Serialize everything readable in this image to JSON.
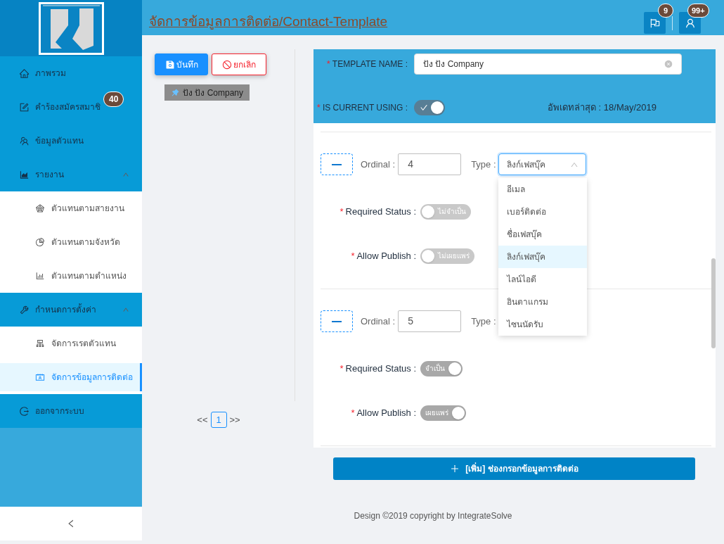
{
  "sidebar": {
    "items": [
      {
        "label": "ภาพรวม",
        "selected": false
      },
      {
        "label": "คำร้องสมัครสมาชิ",
        "badge": "40",
        "selected": false
      },
      {
        "label": "ข้อมูลตัวแทน",
        "selected": false
      },
      {
        "label": "รายงาน",
        "selected": false,
        "expanded": true,
        "children": [
          {
            "label": "ตัวแทนตามสายงาน",
            "selected": false
          },
          {
            "label": "ตัวแทนตามจังหวัด",
            "selected": false
          },
          {
            "label": "ตัวแทนตามตำแหน่ง",
            "selected": false
          }
        ]
      },
      {
        "label": "กำหนดการตั้งค่า",
        "selected": false,
        "expanded": true,
        "children": [
          {
            "label": "จัดการเรตตัวแทน",
            "selected": false
          },
          {
            "label": "จัดการข้อมูลการติดต่อ",
            "selected": true
          }
        ]
      },
      {
        "label": "ออกจากระบบ",
        "selected": false
      }
    ]
  },
  "header": {
    "title": "จัดการข้อมูลการติดต่อ/Contact-Template",
    "actions": [
      {
        "badge": "9"
      },
      {
        "badge": "99+"
      }
    ]
  },
  "toolbar": {
    "buttons": [
      {
        "label": "บันทึก",
        "kind": "primary"
      },
      {
        "label": "ยกเลิก",
        "kind": "danger"
      }
    ],
    "templates": [
      {
        "label": "ปัง ปัง Company"
      }
    ]
  },
  "pagination": {
    "prev": "<<",
    "pages": [
      {
        "label": "1",
        "selected": true
      }
    ],
    "next": ">>"
  },
  "template": {
    "name": {
      "mark": "*",
      "label": "TEMPLATE NAME :",
      "value": "ปัง ปัง Company"
    },
    "current": {
      "mark": "*",
      "label": "IS CURRENT USING :",
      "on": true
    },
    "updated": "อัพเดทล่าสุด : 18/May/2019"
  },
  "contacts": [
    {
      "ordinal": {
        "label": "Ordinal :",
        "value": "4"
      },
      "type": {
        "label": "Type :",
        "value": "ลิงก์เฟสบุ๊ค",
        "open": true,
        "options": [
          {
            "label": "อีเมล",
            "selected": false
          },
          {
            "label": "เบอร์ติดต่อ",
            "selected": false
          },
          {
            "label": "ชื่อเฟสบุ๊ค",
            "selected": false
          },
          {
            "label": "ลิงก์เฟสบุ๊ค",
            "selected": true
          },
          {
            "label": "ไลน์ไอดี",
            "selected": false
          },
          {
            "label": "อินตาแกรม",
            "selected": false
          },
          {
            "label": "ไซนนัดรับ",
            "selected": false
          }
        ]
      },
      "switches": [
        {
          "mark": "*",
          "label": "Required Status :",
          "on": false,
          "text": "ไม่จำเป็น"
        },
        {
          "mark": "*",
          "label": "Allow Publish :",
          "on": false,
          "text": "ไม่เผยแพร่"
        }
      ]
    },
    {
      "ordinal": {
        "label": "Ordinal :",
        "value": "5"
      },
      "type": {
        "label": "Type :"
      },
      "switches": [
        {
          "mark": "*",
          "label": "Required Status :",
          "on": true,
          "text": "จำเป็น"
        },
        {
          "mark": "*",
          "label": "Allow Publish :",
          "on": true,
          "text": "เผยแพร่"
        }
      ]
    }
  ],
  "add_button": "[เพิ่ม] ช่องกรอกข้อมูลการติดต่อ",
  "footer": "Design ©2019 copyright by IntegrateSolve"
}
